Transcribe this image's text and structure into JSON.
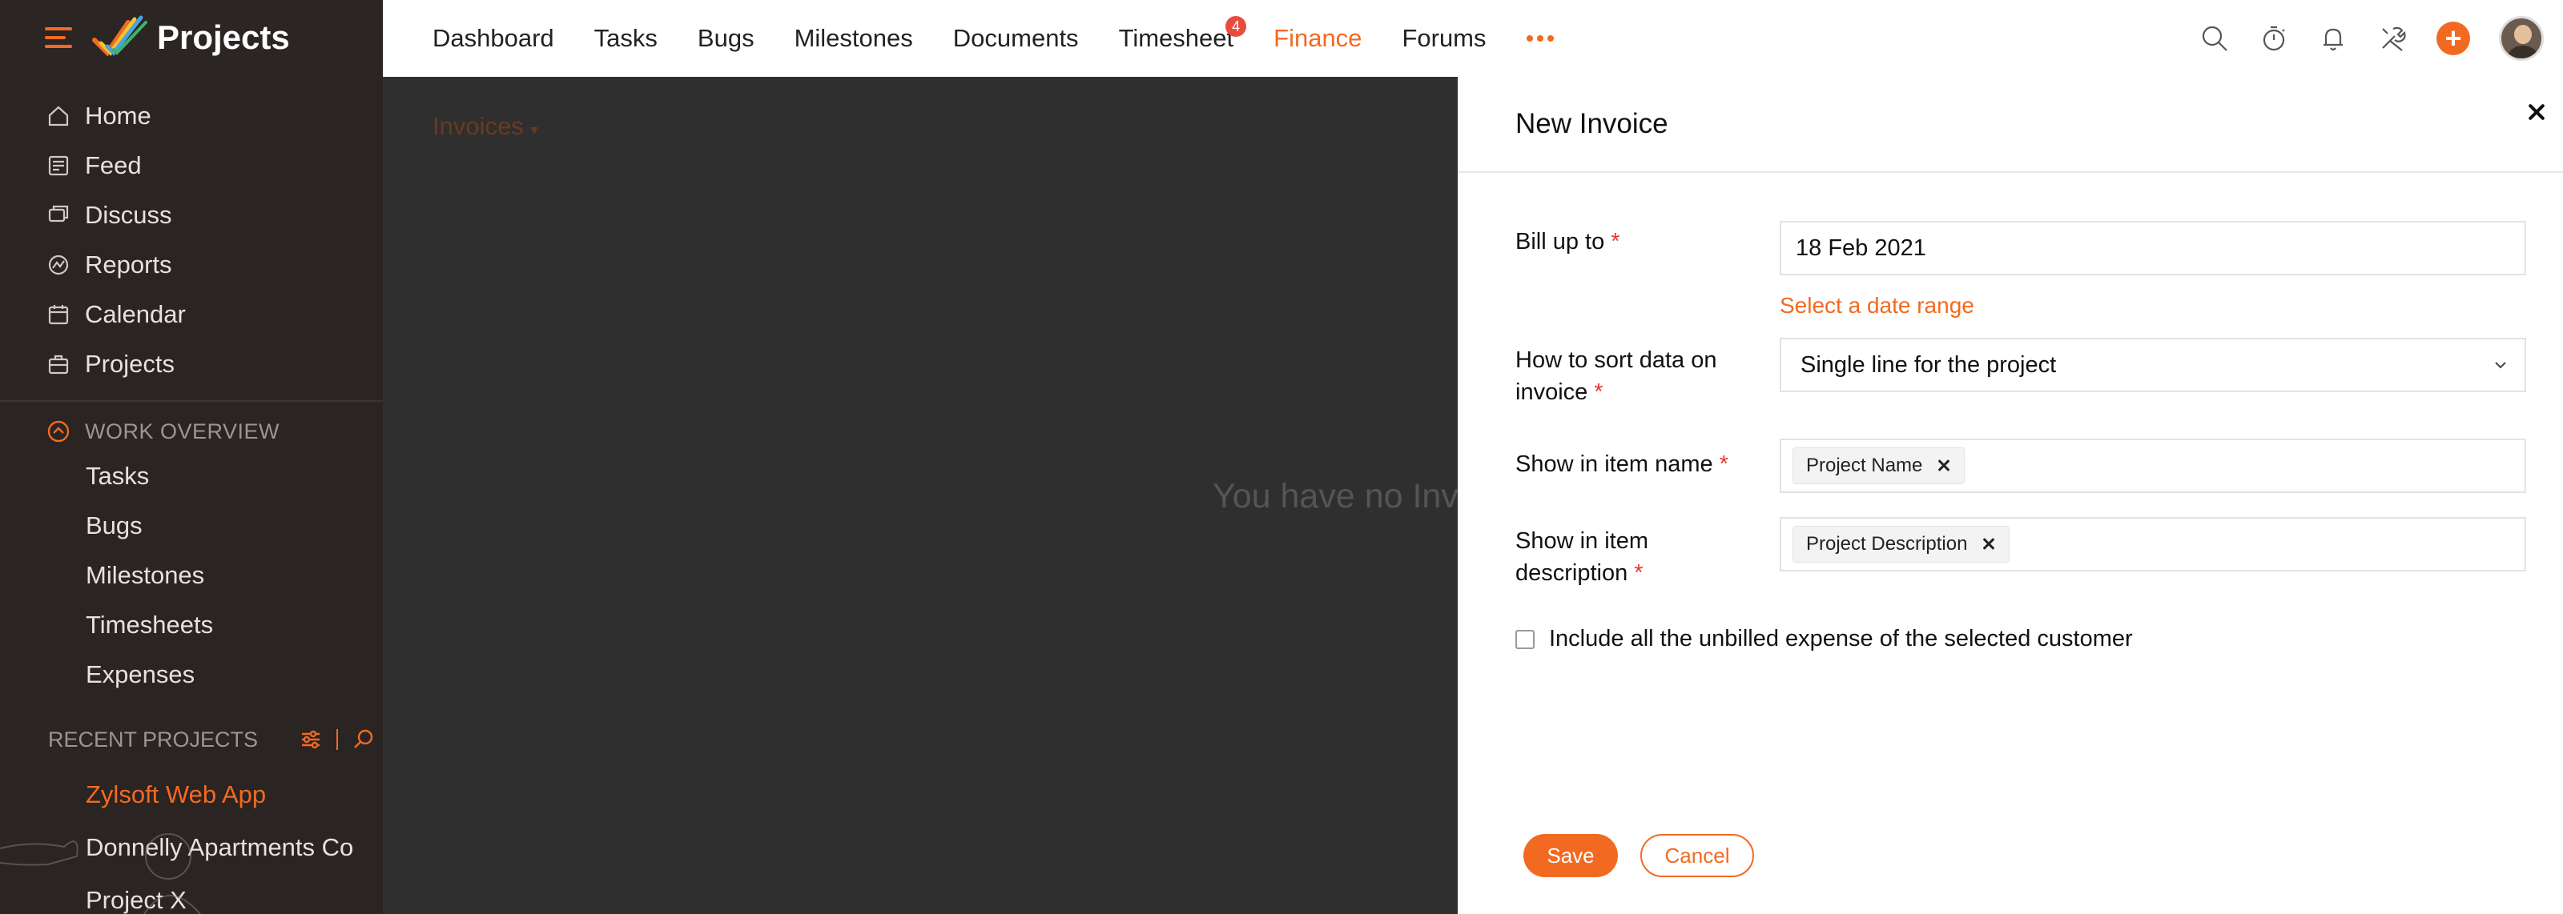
{
  "app": {
    "title": "Projects"
  },
  "sidebar": {
    "nav": [
      {
        "label": "Home",
        "icon": "home-icon"
      },
      {
        "label": "Feed",
        "icon": "feed-icon"
      },
      {
        "label": "Discuss",
        "icon": "discuss-icon"
      },
      {
        "label": "Reports",
        "icon": "reports-icon"
      },
      {
        "label": "Calendar",
        "icon": "calendar-icon"
      },
      {
        "label": "Projects",
        "icon": "projects-icon"
      }
    ],
    "work_overview": {
      "title": "WORK OVERVIEW",
      "items": [
        "Tasks",
        "Bugs",
        "Milestones",
        "Timesheets",
        "Expenses"
      ]
    },
    "recent_projects": {
      "title": "RECENT PROJECTS",
      "items": [
        "Zylsoft Web App",
        "Donnelly Apartments Co",
        "Project X"
      ]
    }
  },
  "topnav": {
    "tabs": [
      "Dashboard",
      "Tasks",
      "Bugs",
      "Milestones",
      "Documents",
      "Timesheet",
      "Finance",
      "Forums"
    ],
    "active": "Finance",
    "timesheet_badge": "4"
  },
  "main": {
    "breadcrumb": "Invoices",
    "empty_message": "You have no Inv"
  },
  "panel": {
    "title": "New Invoice",
    "bill_up_to": {
      "label": "Bill up to",
      "value": "18 Feb 2021",
      "link": "Select a date range"
    },
    "sort": {
      "label_line1": "How to sort data on",
      "label_line2": "invoice",
      "value": "Single line for the project"
    },
    "item_name": {
      "label": "Show in item name",
      "tag": "Project Name"
    },
    "item_desc": {
      "label_line1": "Show in item",
      "label_line2": "description",
      "tag": "Project Description"
    },
    "checkbox_label": "Include all the unbilled expense of the selected customer",
    "save": "Save",
    "cancel": "Cancel"
  },
  "colors": {
    "accent": "#f26a21",
    "sidebar_bg": "#2a2422",
    "required": "#e53935"
  }
}
